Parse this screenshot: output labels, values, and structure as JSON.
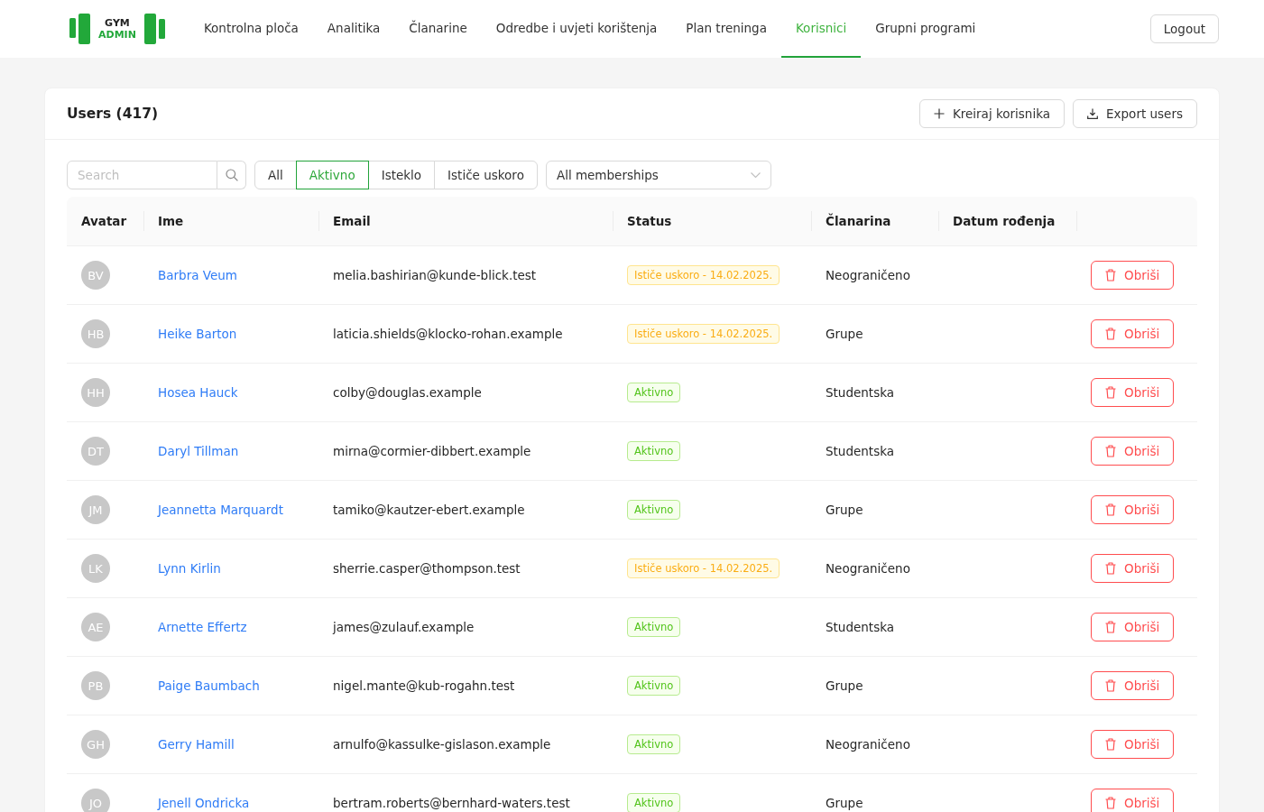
{
  "header": {
    "logo": {
      "line_1": "GYM",
      "line_2": "ADMIN"
    },
    "nav": [
      {
        "label": "Kontrolna ploča",
        "selected": false
      },
      {
        "label": "Analitika",
        "selected": false
      },
      {
        "label": "Članarine",
        "selected": false
      },
      {
        "label": "Odredbe i uvjeti korištenja",
        "selected": false
      },
      {
        "label": "Plan treninga",
        "selected": false
      },
      {
        "label": "Korisnici",
        "selected": true
      },
      {
        "label": "Grupni programi",
        "selected": false
      }
    ],
    "logout": "Logout"
  },
  "card": {
    "title": "Users (417)",
    "actions": [
      {
        "kind": "create",
        "label": "Kreiraj korisnika"
      },
      {
        "kind": "export",
        "label": "Export users"
      }
    ]
  },
  "filters": {
    "search": {
      "placeholder": "Search"
    },
    "status_tabs": [
      {
        "label": "All",
        "selected": false
      },
      {
        "label": "Aktivno",
        "selected": true
      },
      {
        "label": "Isteklo",
        "selected": false
      },
      {
        "label": "Ističe uskoro",
        "selected": false
      }
    ],
    "membership_select": "All memberships"
  },
  "table": {
    "columns": [
      "Avatar",
      "Ime",
      "Email",
      "Status",
      "Članarina",
      "Datum rođenja"
    ],
    "rows": [
      {
        "avatar": "BV",
        "name": "Barbra Veum",
        "email": "melia.bashirian@kunde-blick.test",
        "status": {
          "kind": "expiring",
          "label": "Ističe uskoro - 14.02.2025."
        },
        "membership": "Neograničeno",
        "action": "Obriši"
      },
      {
        "avatar": "HB",
        "name": "Heike Barton",
        "email": "laticia.shields@klocko-rohan.example",
        "status": {
          "kind": "expiring",
          "label": "Ističe uskoro - 14.02.2025."
        },
        "membership": "Grupe",
        "action": "Obriši"
      },
      {
        "avatar": "HH",
        "name": "Hosea Hauck",
        "email": "colby@douglas.example",
        "status": {
          "kind": "active",
          "label": "Aktivno"
        },
        "membership": "Studentska",
        "action": "Obriši"
      },
      {
        "avatar": "DT",
        "name": "Daryl Tillman",
        "email": "mirna@cormier-dibbert.example",
        "status": {
          "kind": "active",
          "label": "Aktivno"
        },
        "membership": "Studentska",
        "action": "Obriši"
      },
      {
        "avatar": "JM",
        "name": "Jeannetta Marquardt",
        "email": "tamiko@kautzer-ebert.example",
        "status": {
          "kind": "active",
          "label": "Aktivno"
        },
        "membership": "Grupe",
        "action": "Obriši"
      },
      {
        "avatar": "LK",
        "name": "Lynn Kirlin",
        "email": "sherrie.casper@thompson.test",
        "status": {
          "kind": "expiring",
          "label": "Ističe uskoro - 14.02.2025."
        },
        "membership": "Neograničeno",
        "action": "Obriši"
      },
      {
        "avatar": "AE",
        "name": "Arnette Effertz",
        "email": "james@zulauf.example",
        "status": {
          "kind": "active",
          "label": "Aktivno"
        },
        "membership": "Studentska",
        "action": "Obriši"
      },
      {
        "avatar": "PB",
        "name": "Paige Baumbach",
        "email": "nigel.mante@kub-rogahn.test",
        "status": {
          "kind": "active",
          "label": "Aktivno"
        },
        "membership": "Grupe",
        "action": "Obriši"
      },
      {
        "avatar": "GH",
        "name": "Gerry Hamill",
        "email": "arnulfo@kassulke-gislason.example",
        "status": {
          "kind": "active",
          "label": "Aktivno"
        },
        "membership": "Neograničeno",
        "action": "Obriši"
      },
      {
        "avatar": "JO",
        "name": "Jenell Ondricka",
        "email": "bertram.roberts@bernhard-waters.test",
        "status": {
          "kind": "active",
          "label": "Aktivno"
        },
        "membership": "Grupe",
        "action": "Obriši"
      }
    ]
  }
}
